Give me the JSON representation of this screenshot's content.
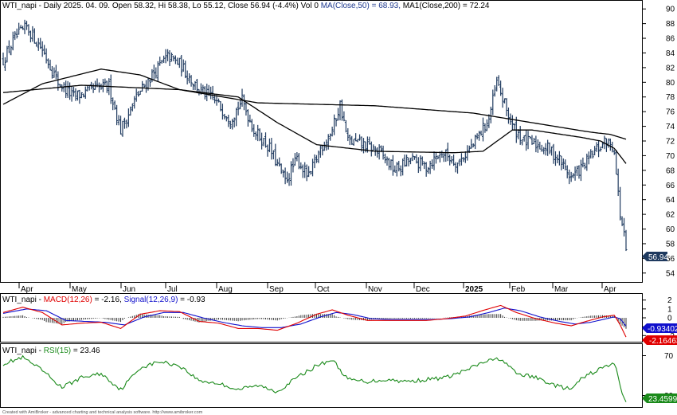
{
  "price_panel": {
    "symbol": "WTI_napi",
    "info": " - Daily 2025. 04. 09. Open 58.32, Hi 58.38, Lo 55.12, Close 56.94 (-4.4%) Vol 0 ",
    "ma50_label": "MA(Close,50) = 68.93,",
    "ma200_label": " MA1(Close,200) = 72.24",
    "last_close_tag": "56.94"
  },
  "macd_panel": {
    "symbol": "WTI_napi",
    "sep": " - ",
    "macd_label": "MACD(12,26)",
    "macd_value": " = -2.16, ",
    "signal_label": "Signal(12,26,9)",
    "signal_value": " = -0.93",
    "signal_tag": "-0.934029",
    "macd_tag": "-2.16463"
  },
  "rsi_panel": {
    "symbol": "WTI_napi",
    "sep": " - ",
    "rsi_label": "RSI(15)",
    "rsi_value": " = 23.46",
    "rsi_tag": "23.4599"
  },
  "footer": "Created with AmiBroker - advanced charting and technical analysis software. http://www.amibroker.com",
  "colors": {
    "macd": "#e00000",
    "signal": "#1010cc",
    "rsi": "#1a8a1a",
    "price_tag": "#1f3a5f",
    "bars": "#1f3a5f"
  },
  "chart_data": [
    {
      "type": "line",
      "title": "WTI_napi - Daily",
      "ylim": [
        53,
        91
      ],
      "y_ticks": [
        54,
        56,
        58,
        60,
        62,
        64,
        66,
        68,
        70,
        72,
        74,
        76,
        78,
        80,
        82,
        84,
        86,
        88,
        90
      ],
      "x_month_labels": [
        "Apr",
        "May",
        "Jun",
        "Jul",
        "Aug",
        "Sep",
        "Oct",
        "Nov",
        "Dec",
        "2025",
        "Feb",
        "Mar",
        "Apr"
      ],
      "series": [
        {
          "name": "WTI_napi",
          "style": "ohlc-bars",
          "anchors": [
            [
              0,
              83
            ],
            [
              6,
              86
            ],
            [
              12,
              87.5
            ],
            [
              20,
              84.5
            ],
            [
              28,
              80
            ],
            [
              36,
              78
            ],
            [
              46,
              79
            ],
            [
              54,
              79.5
            ],
            [
              60,
              73.5
            ],
            [
              68,
              78
            ],
            [
              76,
              81
            ],
            [
              84,
              83.5
            ],
            [
              90,
              82.5
            ],
            [
              100,
              79
            ],
            [
              108,
              77.5
            ],
            [
              116,
              75
            ],
            [
              122,
              77.5
            ],
            [
              128,
              73.5
            ],
            [
              136,
              71
            ],
            [
              144,
              66.5
            ],
            [
              150,
              69.5
            ],
            [
              156,
              67
            ],
            [
              162,
              71
            ],
            [
              168,
              73.5
            ],
            [
              172,
              77
            ],
            [
              176,
              72
            ],
            [
              184,
              71.5
            ],
            [
              192,
              70.5
            ],
            [
              200,
              68
            ],
            [
              208,
              69.5
            ],
            [
              216,
              68.5
            ],
            [
              224,
              70.5
            ],
            [
              232,
              69
            ],
            [
              240,
              71.5
            ],
            [
              248,
              75
            ],
            [
              252,
              80
            ],
            [
              256,
              77
            ],
            [
              260,
              74
            ],
            [
              266,
              72
            ],
            [
              272,
              71.5
            ],
            [
              278,
              71
            ],
            [
              284,
              69.5
            ],
            [
              290,
              67
            ],
            [
              296,
              68.5
            ],
            [
              302,
              70.5
            ],
            [
              308,
              72
            ],
            [
              312,
              71
            ],
            [
              313,
              67.5
            ],
            [
              315,
              62
            ],
            [
              317,
              59
            ],
            [
              318,
              56.94
            ]
          ]
        },
        {
          "name": "MA(Close,50)",
          "style": "line",
          "anchors": [
            [
              0,
              77
            ],
            [
              20,
              79.8
            ],
            [
              50,
              81.8
            ],
            [
              70,
              81
            ],
            [
              90,
              79
            ],
            [
              120,
              78
            ],
            [
              140,
              74.5
            ],
            [
              160,
              71.5
            ],
            [
              190,
              70.6
            ],
            [
              230,
              70.4
            ],
            [
              245,
              70.6
            ],
            [
              260,
              73.5
            ],
            [
              270,
              73.5
            ],
            [
              295,
              72.5
            ],
            [
              305,
              72
            ],
            [
              312,
              71
            ],
            [
              318,
              68.93
            ]
          ]
        },
        {
          "name": "MA1(Close,200)",
          "style": "line",
          "anchors": [
            [
              0,
              78.6
            ],
            [
              40,
              79.6
            ],
            [
              90,
              79
            ],
            [
              130,
              77.2
            ],
            [
              190,
              76.8
            ],
            [
              240,
              75.8
            ],
            [
              270,
              74.5
            ],
            [
              300,
              73.2
            ],
            [
              310,
              72.9
            ],
            [
              318,
              72.24
            ]
          ]
        }
      ]
    },
    {
      "type": "line",
      "title": "MACD",
      "ylim": [
        -2.6,
        2.6
      ],
      "y_ticks": [
        -2,
        -1,
        0,
        1,
        2
      ],
      "series": [
        {
          "name": "MACD(12,26)",
          "anchors": [
            [
              0,
              0.6
            ],
            [
              10,
              1.2
            ],
            [
              20,
              0.6
            ],
            [
              30,
              -0.8
            ],
            [
              40,
              -0.6
            ],
            [
              50,
              -0.5
            ],
            [
              60,
              -1.2
            ],
            [
              70,
              0.4
            ],
            [
              80,
              0.8
            ],
            [
              90,
              0.7
            ],
            [
              100,
              -0.4
            ],
            [
              110,
              -0.6
            ],
            [
              120,
              -1.2
            ],
            [
              130,
              -1.2
            ],
            [
              140,
              -1.4
            ],
            [
              150,
              -0.6
            ],
            [
              160,
              0.4
            ],
            [
              168,
              0.9
            ],
            [
              176,
              0.3
            ],
            [
              186,
              -0.3
            ],
            [
              196,
              -0.3
            ],
            [
              206,
              -0.3
            ],
            [
              216,
              -0.3
            ],
            [
              226,
              -0.1
            ],
            [
              236,
              0.2
            ],
            [
              246,
              0.9
            ],
            [
              254,
              1.4
            ],
            [
              262,
              0.6
            ],
            [
              272,
              -0.1
            ],
            [
              282,
              -0.6
            ],
            [
              290,
              -0.9
            ],
            [
              296,
              -0.5
            ],
            [
              306,
              0.1
            ],
            [
              312,
              0.3
            ],
            [
              315,
              -0.8
            ],
            [
              318,
              -2.16
            ]
          ]
        },
        {
          "name": "Signal(12,26,9)",
          "anchors": [
            [
              0,
              0.5
            ],
            [
              12,
              1.0
            ],
            [
              22,
              0.8
            ],
            [
              32,
              -0.3
            ],
            [
              42,
              -0.4
            ],
            [
              52,
              -0.5
            ],
            [
              62,
              -0.8
            ],
            [
              72,
              0.1
            ],
            [
              82,
              0.6
            ],
            [
              92,
              0.6
            ],
            [
              102,
              0.0
            ],
            [
              112,
              -0.5
            ],
            [
              122,
              -0.9
            ],
            [
              132,
              -1.1
            ],
            [
              142,
              -1.1
            ],
            [
              152,
              -0.7
            ],
            [
              162,
              0.1
            ],
            [
              170,
              0.6
            ],
            [
              178,
              0.4
            ],
            [
              188,
              -0.1
            ],
            [
              198,
              -0.2
            ],
            [
              208,
              -0.2
            ],
            [
              218,
              -0.2
            ],
            [
              228,
              -0.1
            ],
            [
              238,
              0.1
            ],
            [
              248,
              0.6
            ],
            [
              256,
              1.1
            ],
            [
              264,
              0.8
            ],
            [
              274,
              0.1
            ],
            [
              284,
              -0.4
            ],
            [
              292,
              -0.7
            ],
            [
              300,
              -0.5
            ],
            [
              308,
              -0.1
            ],
            [
              312,
              0.1
            ],
            [
              315,
              -0.1
            ],
            [
              318,
              -0.93
            ]
          ]
        }
      ]
    },
    {
      "type": "line",
      "title": "RSI",
      "ylim": [
        20,
        80
      ],
      "y_ticks": [
        30,
        70
      ],
      "series": [
        {
          "name": "RSI(15)",
          "anchors": [
            [
              0,
              62
            ],
            [
              10,
              68
            ],
            [
              20,
              55
            ],
            [
              30,
              38
            ],
            [
              40,
              48
            ],
            [
              50,
              52
            ],
            [
              60,
              36
            ],
            [
              70,
              58
            ],
            [
              80,
              64
            ],
            [
              90,
              60
            ],
            [
              100,
              45
            ],
            [
              110,
              42
            ],
            [
              120,
              36
            ],
            [
              130,
              40
            ],
            [
              140,
              34
            ],
            [
              150,
              48
            ],
            [
              160,
              60
            ],
            [
              168,
              66
            ],
            [
              176,
              46
            ],
            [
              186,
              44
            ],
            [
              196,
              46
            ],
            [
              206,
              44
            ],
            [
              216,
              46
            ],
            [
              226,
              48
            ],
            [
              236,
              55
            ],
            [
              246,
              64
            ],
            [
              254,
              67
            ],
            [
              262,
              52
            ],
            [
              272,
              48
            ],
            [
              282,
              40
            ],
            [
              290,
              36
            ],
            [
              296,
              48
            ],
            [
              306,
              58
            ],
            [
              312,
              62
            ],
            [
              314,
              50
            ],
            [
              316,
              32
            ],
            [
              318,
              23.46
            ]
          ]
        }
      ]
    }
  ]
}
